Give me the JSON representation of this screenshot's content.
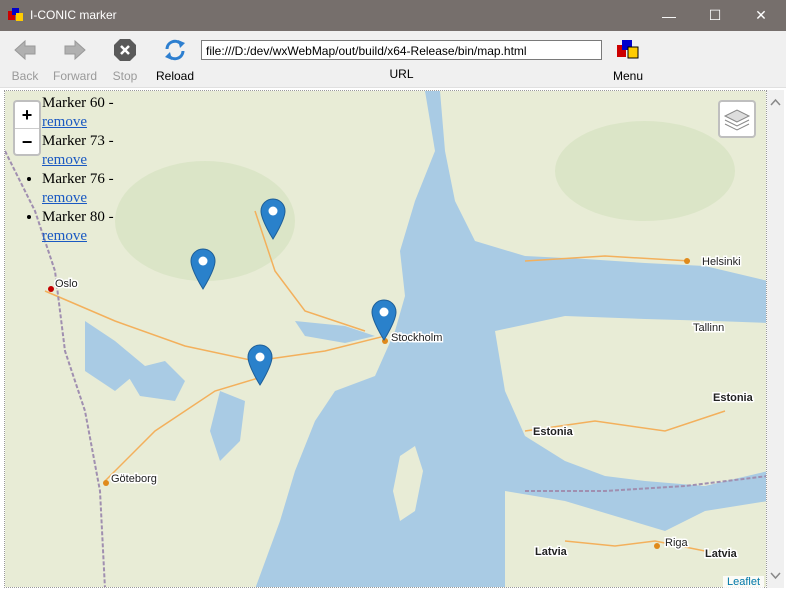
{
  "window": {
    "title": "I-CONIC marker",
    "minimize_glyph": "—",
    "maximize_glyph": "☐",
    "close_glyph": "✕"
  },
  "toolbar": {
    "back_label": "Back",
    "forward_label": "Forward",
    "stop_label": "Stop",
    "reload_label": "Reload",
    "url_value": "file:///D:/dev/wxWebMap/out/build/x64-Release/bin/map.html",
    "url_label": "URL",
    "menu_label": "Menu"
  },
  "markers": [
    {
      "label": "Marker 60 -",
      "action": "remove"
    },
    {
      "label": "Marker 73 -",
      "action": "remove"
    },
    {
      "label": "Marker 76 -",
      "action": "remove"
    },
    {
      "label": "Marker 80 -",
      "action": "remove"
    }
  ],
  "map": {
    "zoom_in": "+",
    "zoom_out": "−",
    "attribution": "Leaflet",
    "places": [
      "Oslo",
      "Stockholm",
      "Helsinki",
      "Tallinn",
      "Estonia",
      "Estonia",
      "Göteborg",
      "Riga",
      "Latvia",
      "Latvia"
    ],
    "marker_color": "#2a81cb",
    "water_color": "#a9cbe4",
    "land_color": "#e7ecd4"
  }
}
